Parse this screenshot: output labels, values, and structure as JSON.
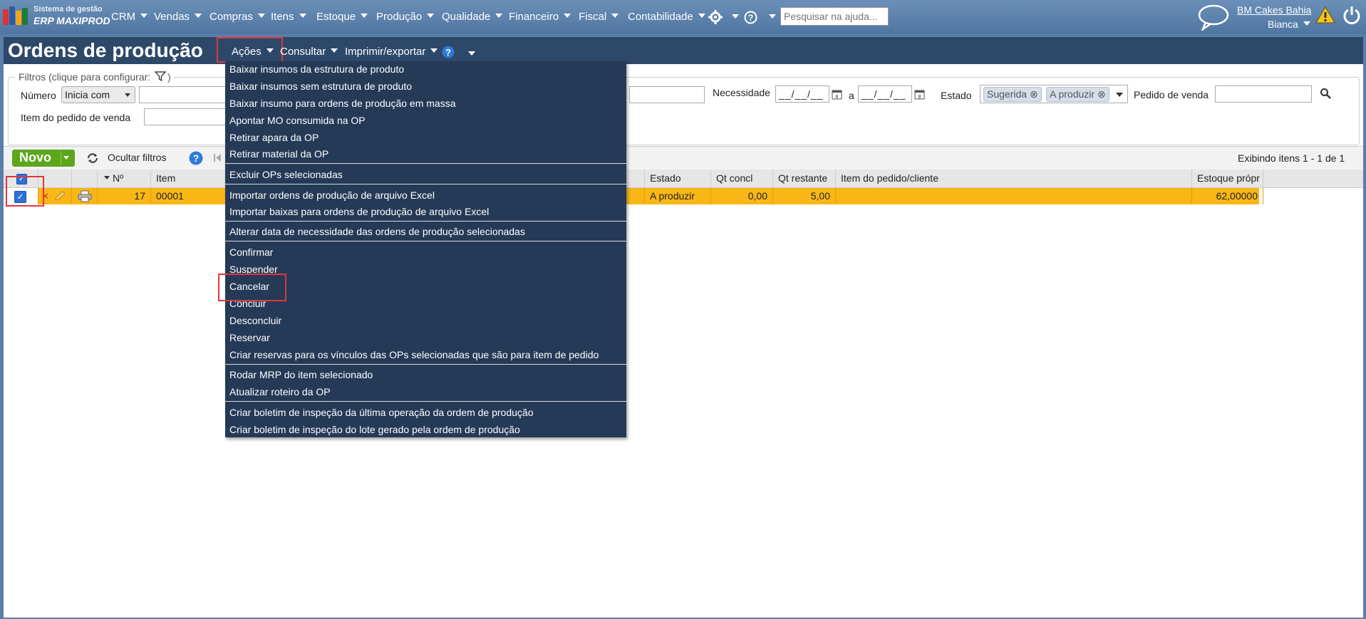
{
  "app": {
    "brand_line1": "Sistema de gestão",
    "brand_line2": "ERP MAXIPROD"
  },
  "top_menu": [
    {
      "label": "CRM"
    },
    {
      "label": "Vendas"
    },
    {
      "label": "Compras"
    },
    {
      "label": "Itens"
    },
    {
      "label": "Estoque"
    },
    {
      "label": "Produção"
    },
    {
      "label": "Qualidade"
    },
    {
      "label": "Financeiro"
    },
    {
      "label": "Fiscal"
    },
    {
      "label": "Contabilidade"
    }
  ],
  "search_help": {
    "placeholder": "Pesquisar na ajuda..."
  },
  "user": {
    "company": "BM Cakes Bahia",
    "name": "Bianca"
  },
  "page": {
    "title": "Ordens de produção",
    "submenu": {
      "acoes": "Ações",
      "consultar": "Consultar",
      "imprimir": "Imprimir/exportar"
    }
  },
  "filters": {
    "legend": "Filtros (clique para configurar:",
    "legend_end": ")",
    "numero_label": "Número",
    "numero_mode": "Inicia com",
    "necessidade_label": "Necessidade",
    "date_from": "__/__/__",
    "date_sep": "a",
    "date_to": "__/__/__",
    "estado_label": "Estado",
    "estado_chips": [
      "Sugerida",
      "A produzir"
    ],
    "pedido_label": "Pedido de venda",
    "item_pedido_label": "Item do pedido de venda"
  },
  "toolbar": {
    "novo": "Novo",
    "ocultar": "Ocultar filtros",
    "paging": "Exibindo itens 1 - 1 de 1"
  },
  "table": {
    "headers": {
      "no": "Nº",
      "item": "Item",
      "estado": "Estado",
      "qt_concl": "Qt concl",
      "qt_restante": "Qt restante",
      "item_pedido": "Item do pedido/cliente",
      "estoque": "Estoque própr"
    },
    "row": {
      "no": "17",
      "item": "00001",
      "estado": "A produzir",
      "qt_concl": "0,00",
      "qt_restante": "5,00",
      "item_pedido": "",
      "estoque": "62,00000"
    }
  },
  "actions_menu": [
    "Baixar insumos da estrutura de produto",
    "Baixar insumos sem estrutura de produto",
    "Baixar insumo para ordens de produção em massa",
    "Apontar MO consumida na OP",
    "Retirar apara da OP",
    "Retirar material da OP",
    "Excluir OPs selecionadas",
    "Importar ordens de produção de arquivo Excel",
    "Importar baixas para ordens de produção de arquivo Excel",
    "Alterar data de necessidade das ordens de produção selecionadas",
    "Confirmar",
    "Suspender",
    "Cancelar",
    "Concluir",
    "Desconcluir",
    "Reservar",
    "Criar reservas para os vínculos das OPs selecionadas que são para item de pedido",
    "Rodar MRP do item selecionado",
    "Atualizar roteiro da OP",
    "Criar boletim de inspeção da última operação da ordem de produção",
    "Criar boletim de inspeção do lote gerado pela ordem de produção"
  ],
  "colors": {
    "header_blue": "#4f76a2",
    "title_bar": "#2d4869",
    "menu_bg": "#253a57",
    "row_highlight": "#f8b717",
    "accent_green": "#5ca61c",
    "highlight_red": "#e0363b"
  }
}
